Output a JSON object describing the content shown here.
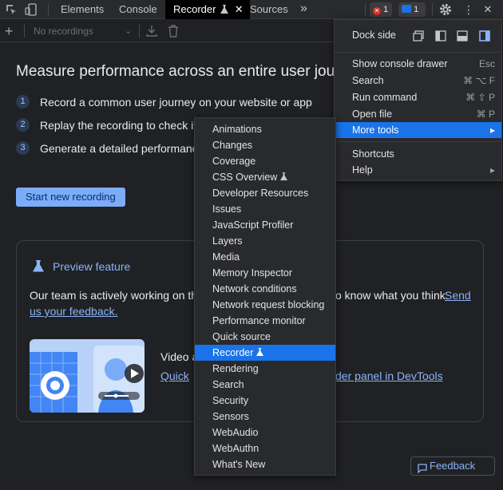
{
  "tabbar": {
    "tabs": [
      "Elements",
      "Console",
      "Recorder",
      "Sources"
    ],
    "active_tab": "Recorder",
    "more_tabs": "»",
    "errors_count": "1",
    "messages_count": "1"
  },
  "toolbar": {
    "recordings_select": "No recordings"
  },
  "main": {
    "heading": "Measure performance across an entire user journey",
    "steps": [
      {
        "num": "1",
        "text": "Record a common user journey on your website or app"
      },
      {
        "num": "2",
        "text": "Replay the recording to check if the flow is working"
      },
      {
        "num": "3",
        "text": "Generate a detailed performance trace"
      }
    ],
    "start_button": "Start new recording"
  },
  "preview": {
    "title": "Preview feature",
    "text_before": "Our team is actively working on this feature and we would love to know what you think.",
    "text_left": "Our team is actively working on thi",
    "text_right": "o know what you think.",
    "link_send": "Send",
    "link_feedback": "us your feedback.",
    "video_label": "Video a",
    "video_link_left": "Quick",
    "video_link_right": "der panel in DevTools"
  },
  "feedback_button": "Feedback",
  "main_menu": {
    "dock_side": "Dock side",
    "items": [
      {
        "label": "Show console drawer",
        "shortcut": "Esc"
      },
      {
        "label": "Search",
        "shortcut": "⌘ ⌥ F"
      },
      {
        "label": "Run command",
        "shortcut": "⌘ ⇧ P"
      },
      {
        "label": "Open file",
        "shortcut": "⌘ P"
      },
      {
        "label": "More tools",
        "shortcut": "▸"
      },
      {
        "label": "Shortcuts",
        "shortcut": ""
      },
      {
        "label": "Help",
        "shortcut": "▸"
      }
    ]
  },
  "more_tools": {
    "items": [
      "Animations",
      "Changes",
      "Coverage",
      "CSS Overview",
      "Developer Resources",
      "Issues",
      "JavaScript Profiler",
      "Layers",
      "Media",
      "Memory Inspector",
      "Network conditions",
      "Network request blocking",
      "Performance monitor",
      "Quick source",
      "Recorder",
      "Rendering",
      "Search",
      "Security",
      "Sensors",
      "WebAudio",
      "WebAuthn",
      "What's New"
    ],
    "highlighted": "Recorder"
  },
  "colors": {
    "accent": "#1a73e8",
    "link": "#8ab4f8",
    "button": "#7cacf8",
    "background": "#202124",
    "error_badge": "#d93025"
  }
}
